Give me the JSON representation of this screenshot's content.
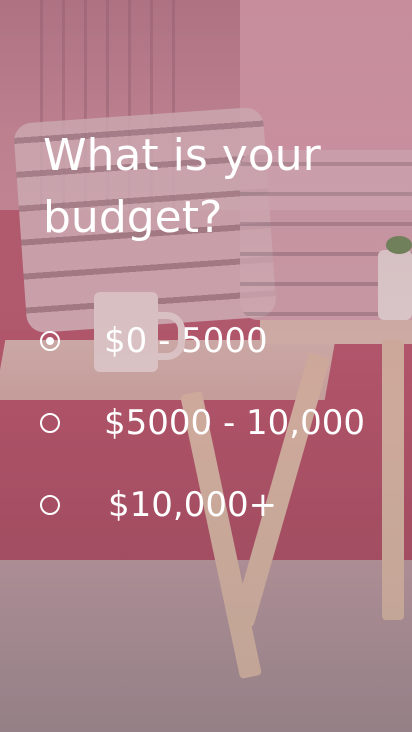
{
  "question": {
    "title": "What is your budget?"
  },
  "options": [
    {
      "label": "$0 - 5000",
      "selected": true
    },
    {
      "label": "$5000 - 10,000",
      "selected": false
    },
    {
      "label": "$10,000+",
      "selected": false
    }
  ],
  "colors": {
    "text": "#ffffff",
    "overlay_tint": "#b0607a"
  },
  "icons": {
    "radio_selected": "radio-selected-icon",
    "radio_unselected": "radio-unselected-icon"
  }
}
